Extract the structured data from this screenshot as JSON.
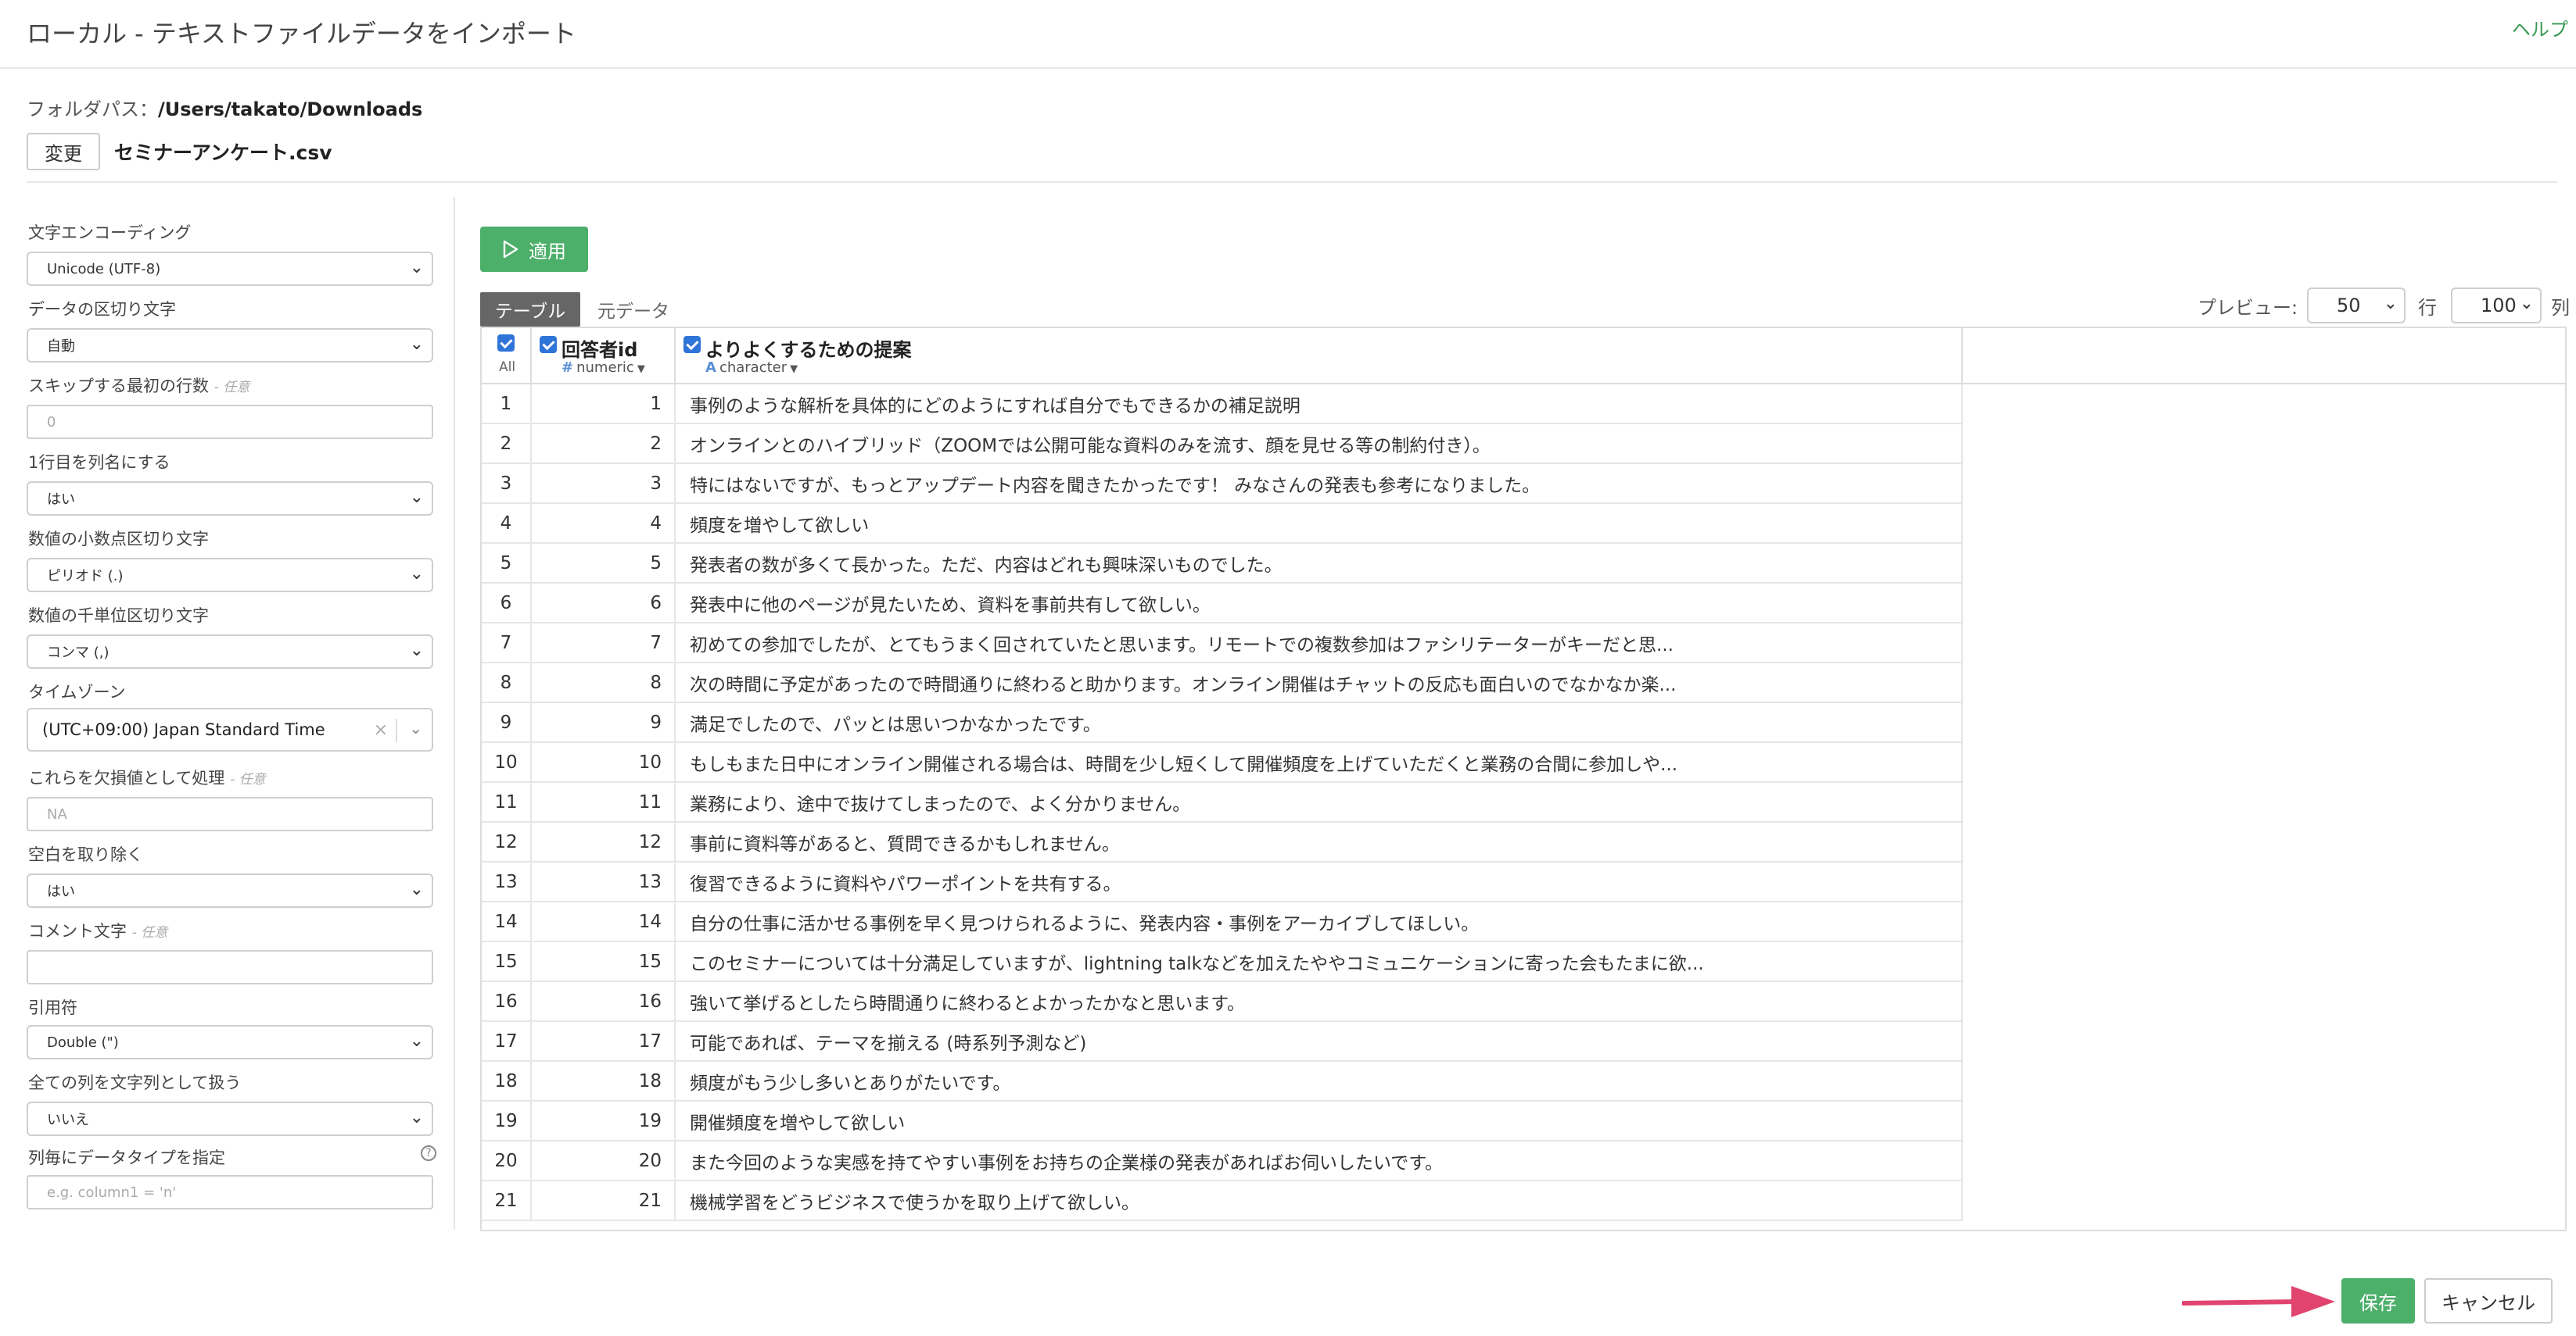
{
  "header": {
    "title": "ローカル - テキストファイルデータをインポート",
    "help": "ヘルプ"
  },
  "folder": {
    "label": "フォルダパス：",
    "path": "/Users/takato/Downloads",
    "change_label": "変更",
    "file_name": "セミナーアンケート.csv"
  },
  "sidebar": {
    "encoding": {
      "label": "文字エンコーディング",
      "value": "Unicode (UTF-8)"
    },
    "delimiter": {
      "label": "データの区切り文字",
      "value": "自動"
    },
    "skip_rows": {
      "label": "スキップする最初の行数",
      "optional": "- 任意",
      "placeholder": "0"
    },
    "header_row": {
      "label": "1行目を列名にする",
      "value": "はい"
    },
    "decimal_mark": {
      "label": "数値の小数点区切り文字",
      "value": "ピリオド (.)"
    },
    "grouping_mark": {
      "label": "数値の千単位区切り文字",
      "value": "コンマ (,)"
    },
    "timezone": {
      "label": "タイムゾーン",
      "value": "(UTC+09:00) Japan Standard Time"
    },
    "na": {
      "label": "これらを欠損値として処理",
      "optional": "- 任意",
      "placeholder": "NA"
    },
    "trim": {
      "label": "空白を取り除く",
      "value": "はい"
    },
    "comment": {
      "label": "コメント文字",
      "optional": "- 任意",
      "placeholder": ""
    },
    "quote": {
      "label": "引用符",
      "value": "Double (\")"
    },
    "all_char": {
      "label": "全ての列を文字列として扱う",
      "value": "いいえ"
    },
    "col_types": {
      "label": "列毎にデータタイプを指定",
      "placeholder": "e.g. column1 = 'n'",
      "help": "?"
    }
  },
  "main": {
    "apply_label": "適用",
    "tabs": [
      "テーブル",
      "元データ"
    ],
    "preview": {
      "label": "プレビュー:",
      "rows": "50",
      "rows_label": "行",
      "cols": "100",
      "cols_label": "列"
    }
  },
  "table": {
    "all_label": "All",
    "columns": [
      {
        "name": "回答者id",
        "type_icon": "#",
        "type": "numeric"
      },
      {
        "name": "よりよくするための提案",
        "type_icon": "A",
        "type": "character"
      }
    ],
    "rows": [
      {
        "idx": "1",
        "id": "1",
        "text": "事例のような解析を具体的にどのようにすれば自分でもできるかの補足説明"
      },
      {
        "idx": "2",
        "id": "2",
        "text": "オンラインとのハイブリッド（ZOOMでは公開可能な資料のみを流す、顔を見せる等の制約付き）。"
      },
      {
        "idx": "3",
        "id": "3",
        "text": "特にはないですが、もっとアップデート内容を聞きたかったです！ みなさんの発表も参考になりました。"
      },
      {
        "idx": "4",
        "id": "4",
        "text": "頻度を増やして欲しい"
      },
      {
        "idx": "5",
        "id": "5",
        "text": "発表者の数が多くて長かった。ただ、内容はどれも興味深いものでした。"
      },
      {
        "idx": "6",
        "id": "6",
        "text": "発表中に他のページが見たいため、資料を事前共有して欲しい。"
      },
      {
        "idx": "7",
        "id": "7",
        "text": "初めての参加でしたが、とてもうまく回されていたと思います。リモートでの複数参加はファシリテーターがキーだと思..."
      },
      {
        "idx": "8",
        "id": "8",
        "text": "次の時間に予定があったので時間通りに終わると助かります。オンライン開催はチャットの反応も面白いのでなかなか楽..."
      },
      {
        "idx": "9",
        "id": "9",
        "text": "満足でしたので、パッとは思いつかなかったです。"
      },
      {
        "idx": "10",
        "id": "10",
        "text": "もしもまた日中にオンライン開催される場合は、時間を少し短くして開催頻度を上げていただくと業務の合間に参加しや..."
      },
      {
        "idx": "11",
        "id": "11",
        "text": "業務により、途中で抜けてしまったので、よく分かりません。"
      },
      {
        "idx": "12",
        "id": "12",
        "text": "事前に資料等があると、質問できるかもしれません。"
      },
      {
        "idx": "13",
        "id": "13",
        "text": "復習できるように資料やパワーポイントを共有する。"
      },
      {
        "idx": "14",
        "id": "14",
        "text": "自分の仕事に活かせる事例を早く見つけられるように、発表内容・事例をアーカイブしてほしい。"
      },
      {
        "idx": "15",
        "id": "15",
        "text": "このセミナーについては十分満足していますが、lightning talkなどを加えたややコミュニケーションに寄った会もたまに欲..."
      },
      {
        "idx": "16",
        "id": "16",
        "text": "強いて挙げるとしたら時間通りに終わるとよかったかなと思います。"
      },
      {
        "idx": "17",
        "id": "17",
        "text": "可能であれば、テーマを揃える (時系列予測など)"
      },
      {
        "idx": "18",
        "id": "18",
        "text": "頻度がもう少し多いとありがたいです。"
      },
      {
        "idx": "19",
        "id": "19",
        "text": "開催頻度を増やして欲しい"
      },
      {
        "idx": "20",
        "id": "20",
        "text": "また今回のような実感を持てやすい事例をお持ちの企業様の発表があればお伺いしたいです。"
      },
      {
        "idx": "21",
        "id": "21",
        "text": "機械学習をどうビジネスで使うかを取り上げて欲しい。"
      }
    ]
  },
  "footer": {
    "save_label": "保存",
    "cancel_label": "キャンセル"
  },
  "colors": {
    "accent_green": "#4caf6a",
    "checkbox_blue": "#2f74d8",
    "arrow_pink": "#e0446f"
  }
}
